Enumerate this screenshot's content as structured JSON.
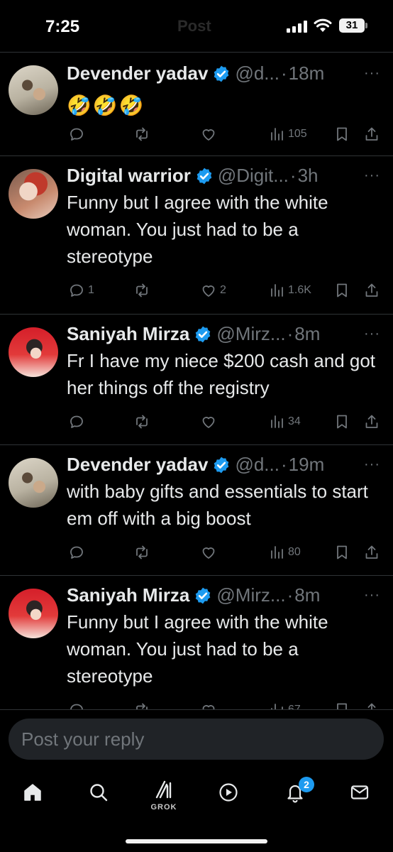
{
  "status_bar": {
    "time": "7:25",
    "ghost_title": "Post",
    "battery": "31"
  },
  "replies": [
    {
      "name": "Devender yadav",
      "handle": "@d...",
      "time": "18m",
      "text": "🤣🤣🤣",
      "stats": {
        "comments": "",
        "reposts": "",
        "likes": "",
        "views": "105"
      }
    },
    {
      "name": "Digital warrior",
      "handle": "@Digit...",
      "time": "3h",
      "text": "Funny but I agree with the white woman. You just had to be a stereotype",
      "stats": {
        "comments": "1",
        "reposts": "",
        "likes": "2",
        "views": "1.6K"
      }
    },
    {
      "name": "Saniyah Mirza",
      "handle": "@Mirz...",
      "time": "8m",
      "text": "Fr I have my niece $200 cash and got her things off the registry",
      "stats": {
        "comments": "",
        "reposts": "",
        "likes": "",
        "views": "34"
      }
    },
    {
      "name": "Devender yadav",
      "handle": "@d...",
      "time": "19m",
      "text": "with baby gifts and essentials to start em off with a big boost",
      "stats": {
        "comments": "",
        "reposts": "",
        "likes": "",
        "views": "80"
      }
    },
    {
      "name": "Saniyah Mirza",
      "handle": "@Mirz...",
      "time": "8m",
      "text": "Funny but I agree with the white woman. You just had to be a stereotype",
      "stats": {
        "comments": "",
        "reposts": "",
        "likes": "",
        "views": "67"
      }
    }
  ],
  "separator": "·",
  "more": "···",
  "reply_box": {
    "placeholder": "Post your reply"
  },
  "tab_bar": {
    "grok_label": "GROK",
    "notification_count": "2"
  },
  "colors": {
    "accent": "#1d9bf0",
    "muted": "#71767b",
    "text": "#e7e9ea",
    "divider": "#2f3336",
    "background": "#000000"
  }
}
